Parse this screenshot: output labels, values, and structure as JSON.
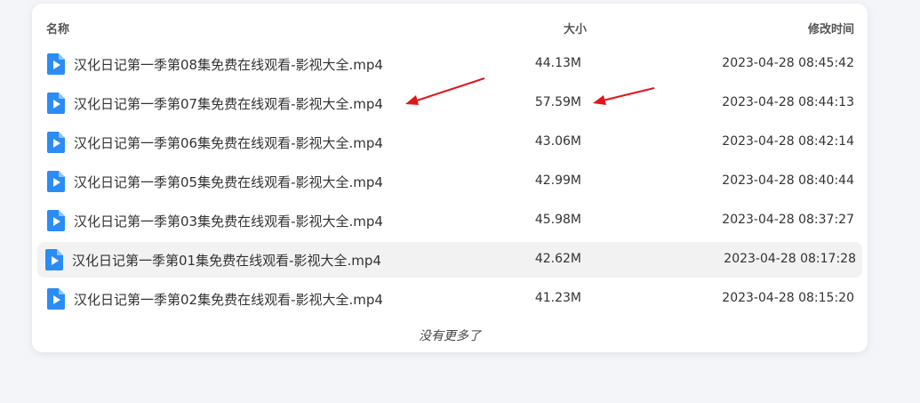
{
  "columns": {
    "name": "名称",
    "size": "大小",
    "time": "修改时间"
  },
  "files": [
    {
      "name": "汉化日记第一季第08集免费在线观看-影视大全.mp4",
      "size": "44.13M",
      "time": "2023-04-28 08:45:42"
    },
    {
      "name": "汉化日记第一季第07集免费在线观看-影视大全.mp4",
      "size": "57.59M",
      "time": "2023-04-28 08:44:13"
    },
    {
      "name": "汉化日记第一季第06集免费在线观看-影视大全.mp4",
      "size": "43.06M",
      "time": "2023-04-28 08:42:14"
    },
    {
      "name": "汉化日记第一季第05集免费在线观看-影视大全.mp4",
      "size": "42.99M",
      "time": "2023-04-28 08:40:44"
    },
    {
      "name": "汉化日记第一季第03集免费在线观看-影视大全.mp4",
      "size": "45.98M",
      "time": "2023-04-28 08:37:27"
    },
    {
      "name": "汉化日记第一季第01集免费在线观看-影视大全.mp4",
      "size": "42.62M",
      "time": "2023-04-28 08:17:28"
    },
    {
      "name": "汉化日记第一季第02集免费在线观看-影视大全.mp4",
      "size": "41.23M",
      "time": "2023-04-28 08:15:20"
    }
  ],
  "footer": "没有更多了",
  "icons": {
    "file": "video-file-icon",
    "annotation": "red-arrow-icon"
  },
  "colors": {
    "icon": "#2a8cf4",
    "arrow": "#e0161b",
    "hover_row": "#f2f2f3"
  }
}
